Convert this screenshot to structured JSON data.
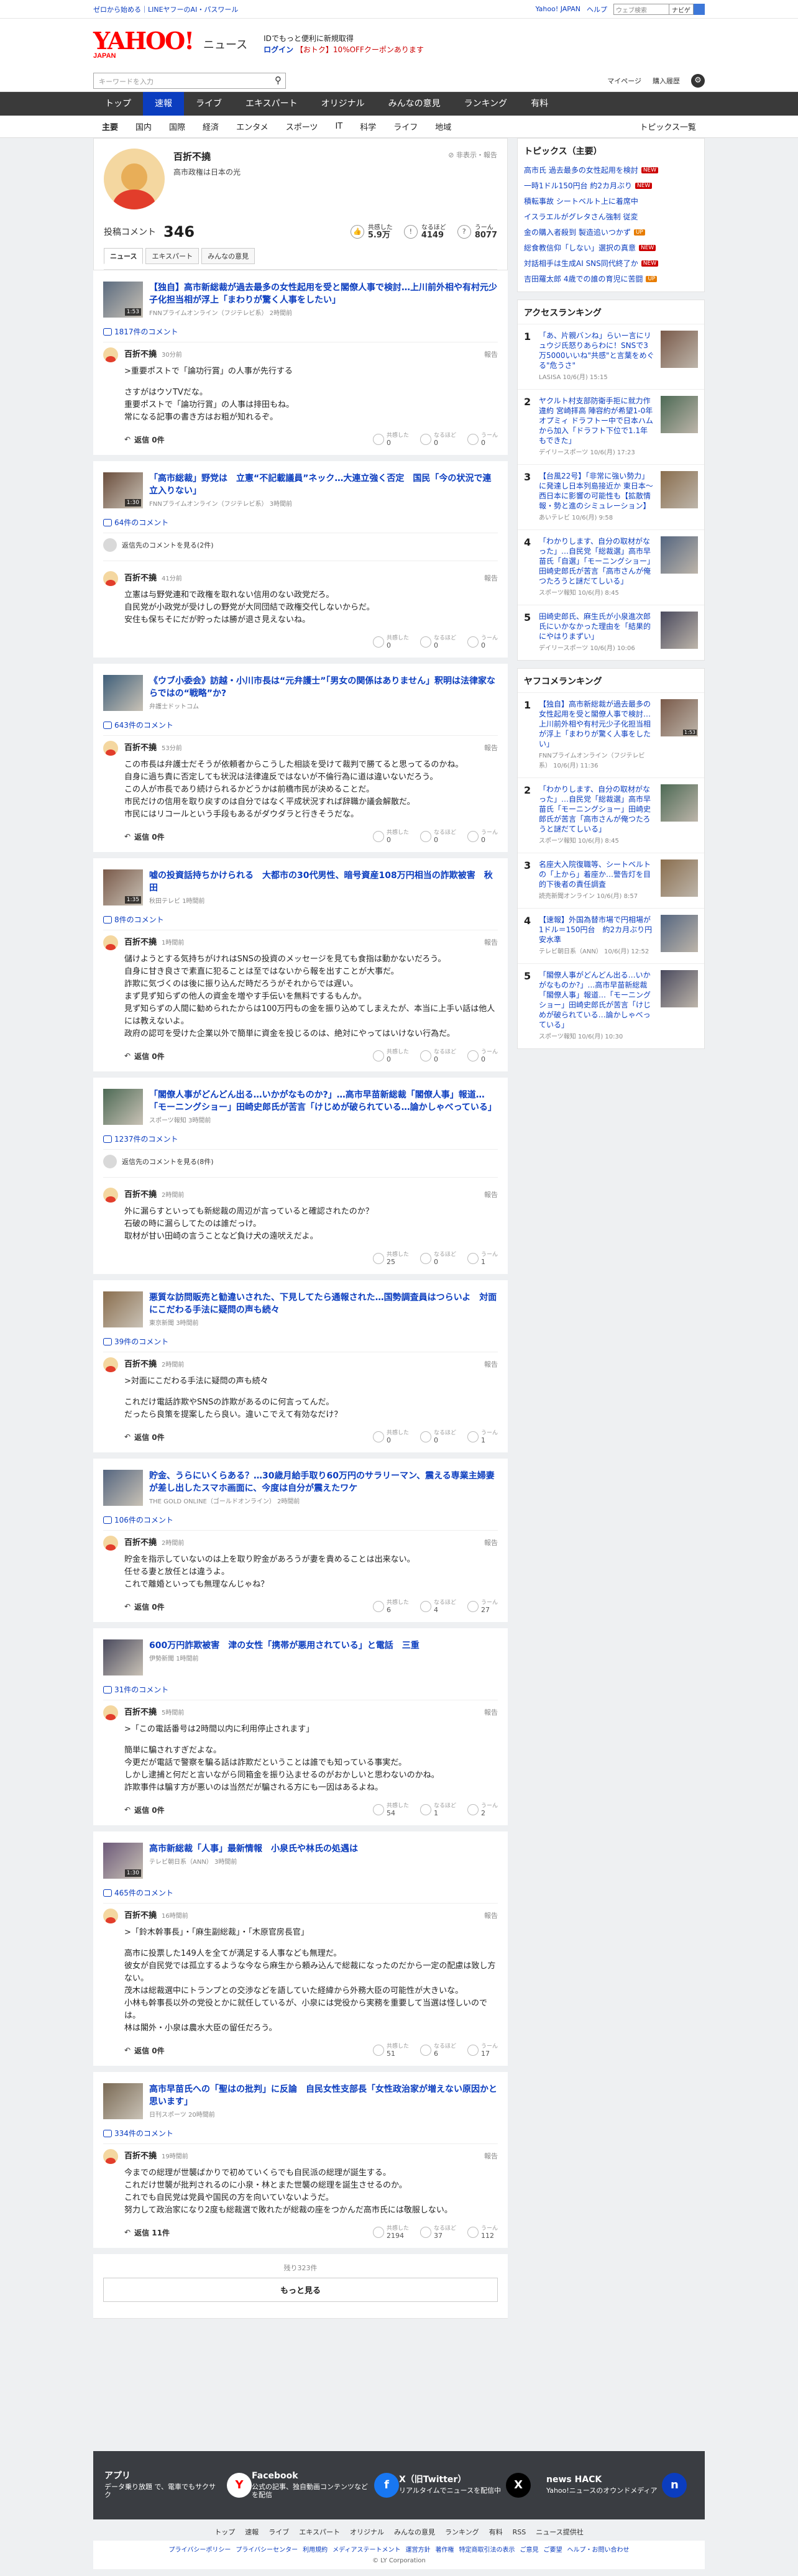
{
  "topbar": {
    "left": "ゼロから始める｜LINEヤフーのAI・パスワール",
    "links": [
      "Yahoo! JAPAN",
      "ヘルプ"
    ],
    "search_placeholder": "ウェブ検索",
    "search_button": "ナビゲ"
  },
  "header": {
    "logo": "YAHOO!",
    "logo_sub": "JAPAN",
    "section": "ニュース",
    "promo_line1": "IDでもっと便利に新規取得",
    "promo_line2": "ログイン",
    "promo_line3": "【おトク】10%OFFクーポンあります"
  },
  "searchrow": {
    "placeholder": "キーワードを入力",
    "links": [
      "マイページ",
      "購入履歴"
    ]
  },
  "nav1": [
    "トップ",
    "速報",
    "ライブ",
    "エキスパート",
    "オリジナル",
    "みんなの意見",
    "ランキング",
    "有料"
  ],
  "nav1_active": 1,
  "nav2": [
    "主要",
    "国内",
    "国際",
    "経済",
    "エンタメ",
    "スポーツ",
    "IT",
    "科学",
    "ライフ",
    "地域"
  ],
  "nav2_right": "トピックス一覧",
  "profile": {
    "name": "百折不撓",
    "bio": "高市政権は日本の光",
    "report": "非表示・報告",
    "label": "投稿コメント",
    "count": "346",
    "stats": [
      {
        "label": "共感した",
        "value": "5.9万"
      },
      {
        "label": "なるほど",
        "value": "4149"
      },
      {
        "label": "うーん",
        "value": "8077"
      }
    ]
  },
  "tabs": [
    "ニュース",
    "エキスパート",
    "みんなの意見"
  ],
  "entries": [
    {
      "title": "【独自】高市新総裁が過去最多の女性起用を受と閣僚人事で検討…上川前外相や有村元少子化担当相が浮上「まわりが驚く人事をしたい」",
      "source": "FNNプライムオンライン（フジテレビ系）",
      "age": "2時間前",
      "duration": "1:53",
      "ccount": "1817件のコメント",
      "user": "百折不撓",
      "time": "30分前",
      "text": [
        ">重要ポストで「論功行賞」の人事が先行する",
        "さすがはウソTVだな。",
        "重要ポストで「論功行賞」の人事は排田もね。",
        "常になる記事の書き方はお粗が知れるぞ。"
      ],
      "reply": "返信 0件",
      "r": [
        "0",
        "0",
        "0"
      ]
    },
    {
      "title": "「高市総裁」野党は　立憲“不記載議員”ネック…大連立強く否定　国民「今の状況で連立入りない」",
      "source": "FNNプライムオンライン（フジテレビ系）",
      "age": "3時間前",
      "duration": "1:30",
      "ccount": "64件のコメント",
      "sub": "返信先のコメントを見る(2件)",
      "user": "百折不撓",
      "time": "41分前",
      "text": [
        "立憲は与野党連和で政権を取れない信用のない政党だろ。",
        "自民党が小政党が受けしの野党が大同団結で政権交代しないからだ。",
        "安住も保ちそにだが貯ったは勝が退さ見えないね。"
      ],
      "reply": "",
      "r": [
        "0",
        "0",
        "0"
      ]
    },
    {
      "title": "《ウブ小委会》訪越・小川市長は“元弁護士”「男女の関係はありません」釈明は法律家ならではの“戦略”か?",
      "source": "弁護士ドットコム",
      "age": "",
      "duration": "",
      "ccount": "643件のコメント",
      "user": "百折不撓",
      "time": "53分前",
      "text": [
        "この市長は弁護士だそうが依頼者からこうした相談を受けて裁判で勝てると思ってるのかね。",
        "自身に過ち責に否定しても状況は法律違反ではないが不倫行為に道は違いないだろう。",
        "この人が市長であり続けられるかどうかは前橋市民が決めることだ。",
        "市民だけの信用を取り戻すのは自分ではなく平成状況すれば辞職か議会解散だ。",
        "市民にはリコールという手段もあるがダウダラと行きそうだな。"
      ],
      "reply": "返信 0件",
      "r": [
        "0",
        "0",
        "0"
      ]
    },
    {
      "title": "嘘の投資話持ちかけられる　大都市の30代男性、暗号資産108万円相当の詐欺被害　秋田",
      "source": "秋田テレビ",
      "age": "1時間前",
      "duration": "1:35",
      "ccount": "8件のコメント",
      "user": "百折不撓",
      "time": "1時間前",
      "text": [
        "儲けようとする気持ちがけれはSNSの投資のメッセージを見ても食指は動かないだろう。",
        "自身に甘き良さで素直に犯ることは至ではないから報を出すことが大事だ。",
        "詐欺に気づくのは後に振り込んだ時だろうがそれからでは遅い。",
        "まず見ず知らずの他人の資金を増やす手伝いを無料でするもんか。",
        "見ず知らずの人間に勧められたからは100万円もの金を振り込めてしまえたが、本当に上手い話は他人には教えないよ。",
        "政府の認可を受けた企業以外で簡単に資金を投じるのは、絶対にやってはいけない行為だ。"
      ],
      "reply": "返信 0件",
      "r": [
        "0",
        "0",
        "0"
      ]
    },
    {
      "title": "「閣僚人事がどんどん出る…いかがなものか?」…高市早苗新総裁「閣僚人事」報道…「モーニングショー」田崎史郎氏が苦言「けじめが破られている…論かしゃべっている」",
      "source": "スポーツ報知",
      "age": "3時間前",
      "duration": "",
      "ccount": "1237件のコメント",
      "sub": "返信先のコメントを見る(8件)",
      "user": "百折不撓",
      "time": "2時間前",
      "text": [
        "外に漏らすといっても新総裁の周辺が言っていると確認されたのか？",
        "石破の時に漏らしてたのは誰だっけ。",
        "取材が甘い田崎の言うことなど負け犬の遠吠えだよ。"
      ],
      "reply": "",
      "r": [
        "25",
        "0",
        "1"
      ]
    },
    {
      "title": "悪質な訪問販売と勧違いされた、下見してたら通報された…国勢調査員はつらいよ　対面にこだわる手法に疑問の声も続々",
      "source": "東京新聞",
      "age": "3時間前",
      "duration": "",
      "ccount": "39件のコメント",
      "user": "百折不撓",
      "time": "2時間前",
      "text": [
        ">対面にこだわる手法に疑問の声も続々",
        "これだけ電話詐欺やSNSの詐欺があるのに何言ってんだ。",
        "だったら良策を提案したら良い。違いこでえて有効なだけ？"
      ],
      "reply": "返信 0件",
      "r": [
        "0",
        "0",
        "1"
      ]
    },
    {
      "title": "貯金、うらにいくらある？…30歳月給手取り60万円のサラリーマン、震える専業主婦妻が差し出したスマホ画面に、今度は自分が震えたワケ",
      "source": "THE GOLD ONLINE（ゴールドオンライン）",
      "age": "2時間前",
      "duration": "",
      "ccount": "106件のコメント",
      "user": "百折不撓",
      "time": "2時間前",
      "text": [
        "貯金を指示していないのは上を取り貯金があろうが妻を貴めることは出来ない。",
        "任せる妻と放任とは違うよ。",
        "これで離婚といっても無理なんじゃね？"
      ],
      "reply": "返信 0件",
      "r": [
        "6",
        "4",
        "27"
      ]
    },
    {
      "title": "600万円詐欺被害　津の女性「携帯が悪用されている」と電話　三重",
      "source": "伊勢新聞",
      "age": "1時間前",
      "duration": "",
      "ccount": "31件のコメント",
      "user": "百折不撓",
      "time": "5時間前",
      "text": [
        ">「この電話番号は2時間以内に利用停止されます」",
        "簡単に騙されすぎだよな。",
        "今更だが電話で警察を騙る話は詐欺だということは誰でも知っている事実だ。",
        "しかし逮捕と何だと言いながら同箱金を振り込ませるのがおかしいと思わないのかね。",
        "詐欺事件は騙す方が悪いのは当然だが騙される方にも一因はあるよね。"
      ],
      "reply": "返信 0件",
      "r": [
        "54",
        "1",
        "2"
      ]
    },
    {
      "title": "高市新総裁「人事」最新情報　小泉氏や林氏の処遇は",
      "source": "テレビ朝日系（ANN）",
      "age": "3時間前",
      "duration": "1:30",
      "ccount": "465件のコメント",
      "user": "百折不撓",
      "time": "16時間前",
      "text": [
        ">「鈴木幹事長」・「麻生副総裁」・「木原官房長官」",
        "高市に投票した149人を全てが満足する人事なども無理だ。",
        "彼女が自民党では孤立するような今なら麻生から頼み込んで総裁になったのだから一定の配慮は致し方ない。",
        "茂木は総裁選中にトランプとの交渉などを語していた経緯から外務大臣の可能性が大きいな。",
        "小林も幹事長以外の党役とかに就任しているが、小泉には党役から実務を重要して当選は怪しいのでは。",
        "林は閣外・小泉は農水大臣の留任だろう。"
      ],
      "reply": "返信 0件",
      "r": [
        "51",
        "6",
        "17"
      ]
    },
    {
      "title": "高市早苗氏への「聖はの批判」に反論　自民女性支部長「女性政治家が増えない原因かと思います」",
      "source": "日刊スポーツ",
      "age": "20時間前",
      "duration": "",
      "ccount": "334件のコメント",
      "user": "百折不撓",
      "time": "19時間前",
      "text": [
        "今までの総理が世襲ばかりで初めていくらでも自民派の総理が誕生する。",
        "これだけ世襲が批判されるのに小泉・林とまた世襲の総理を誕生させるのか。",
        "これでも自民党は党員や国民の方を向いていないようだ。",
        "努力して政治家になり2度も総裁選で敗れたが総裁の座をつかんだ高市氏には敬服しない。"
      ],
      "reply": "返信 11件",
      "r": [
        "2194",
        "37",
        "112"
      ]
    }
  ],
  "more": {
    "remaining": "残り323件",
    "button": "もっと見る"
  },
  "side": {
    "topics_title": "トピックス（主要）",
    "topics": [
      {
        "t": "高市氏 過去最多の女性起用を検討",
        "b": "new"
      },
      {
        "t": "一時1ドル150円台 約2カ月ぶり",
        "b": "new"
      },
      {
        "t": "積転事故 シートベルト上に着席中",
        "b": ""
      },
      {
        "t": "イスラエルがグレタさん強制 従変",
        "b": ""
      },
      {
        "t": "金の購入者殺到 製造追いつかず",
        "b": "up"
      },
      {
        "t": "総食教信仰「しない」選択の真意",
        "b": "new"
      },
      {
        "t": "対話相手は生成AI SNS同代終了か",
        "b": "new"
      },
      {
        "t": "吉田羅太郎 4歳での誰の育児に苦闘",
        "b": "up"
      }
    ],
    "access_title": "アクセスランキング",
    "access": [
      {
        "t": "「あ、片親バンね」らいー言にリュウジ氏怒りあらわに！SNSで3万5000いいね\"共感\"と言葉をめぐる\"危うさ\"",
        "s": "LASISA 10/6(月) 15:15",
        "d": ""
      },
      {
        "t": "ヤクルト村支部防衛手拒に就力作違約 宮崎拝高 陣容約が希望1-0年オプミィ ドラフトー中で日本ハムから加入「ドラフト下位で1.1年もできた」",
        "s": "デイリースポーツ 10/6(月) 17:23",
        "d": ""
      },
      {
        "t": "【台風22号】「非常に強い勢力」に発達し日本列島接近か 東日本〜西日本に影響の可能性も【拡散情報・勢と進のシミュレーション】",
        "s": "あいテレビ 10/6(月) 9:58",
        "d": ""
      },
      {
        "t": "「わかりします、自分の取材がなった」…自民党「総裁選」高市早苗氏「自選」「モーニングショー」田崎史郎氏が苦言「高市さんが俺つたろうと謎だてしいる」",
        "s": "スポーツ報知 10/6(月) 8:45",
        "d": ""
      },
      {
        "t": "田崎史郎氏、麻生氏が小泉進次郎氏にいかなかった理由を「結果的にやはりまずい」",
        "s": "デイリースポーツ 10/6(月) 10:06",
        "d": ""
      }
    ],
    "yahoo_title": "ヤフコメランキング",
    "yahoo": [
      {
        "t": "【独自】高市新総裁が過去最多の女性起用を受と閣僚人事で検討…上川前外相や有村元少子化担当相が浮上「まわりが驚く人事をしたい」",
        "s": "FNNプライムオンライン（フジテレビ系） 10/6(月) 11:36",
        "d": "1:53"
      },
      {
        "t": "「わかりします、自分の取材がなった」…自民党「総裁選」高市早苗氏「モーニングショー」田崎史郎氏が苦言「高市さんが俺つたろうと謎だてしいる」",
        "s": "スポーツ報知 10/6(月) 8:45",
        "d": ""
      },
      {
        "t": "名座大入院復職等、シートベルトの「上から」着座か…警告灯を目的下後者の責任調査",
        "s": "読売新聞オンライン 10/6(月) 8:57",
        "d": ""
      },
      {
        "t": "【速報】外国為替市場で円相場が1ドル＝150円台　約2カ月ぶり円安水準",
        "s": "テレビ朝日系（ANN） 10/6(月) 12:52",
        "d": ""
      },
      {
        "t": "「閣僚人事がどんどん出る…いかがなものか?」…高市早苗新総裁「閣僚人事」報道…「モーニングショー」田崎史郎氏が苦言「けじめが破られている…論かしゃべっている」",
        "s": "スポーツ報知 10/6(月) 10:30",
        "d": ""
      }
    ]
  },
  "footer": {
    "banners": [
      {
        "title": "アプリ",
        "text": "データ乗り放題 で、電車でもサクサク",
        "icon": "Y"
      },
      {
        "title": "Facebook",
        "text": "公式の記事、独自動画コンテンツなどを配信",
        "icon": "f"
      },
      {
        "title": "X（旧Twitter）",
        "text": "リアルタイムでニュースを配信中",
        "icon": "X"
      },
      {
        "title": "news HACK",
        "text": "Yahoo!ニュースのオウンドメディア",
        "icon": "n"
      }
    ],
    "links": [
      "トップ",
      "速報",
      "ライブ",
      "エキスパート",
      "オリジナル",
      "みんなの意見",
      "ランキング",
      "有料",
      "RSS",
      "ニュース提供社"
    ],
    "legal": [
      "プライバシーポリシー",
      "プライバシーセンター",
      "利用規約",
      "メディアステートメント",
      "運営方針",
      "著作権",
      "特定商取引法の表示",
      "ご意見",
      "ご要望",
      "ヘルプ・お問い合わせ"
    ],
    "copy": "© LY Corporation"
  },
  "colors": {
    "accent": "#0b3dbf",
    "nav": "#3a3a3a",
    "brand": "#ff0000"
  }
}
